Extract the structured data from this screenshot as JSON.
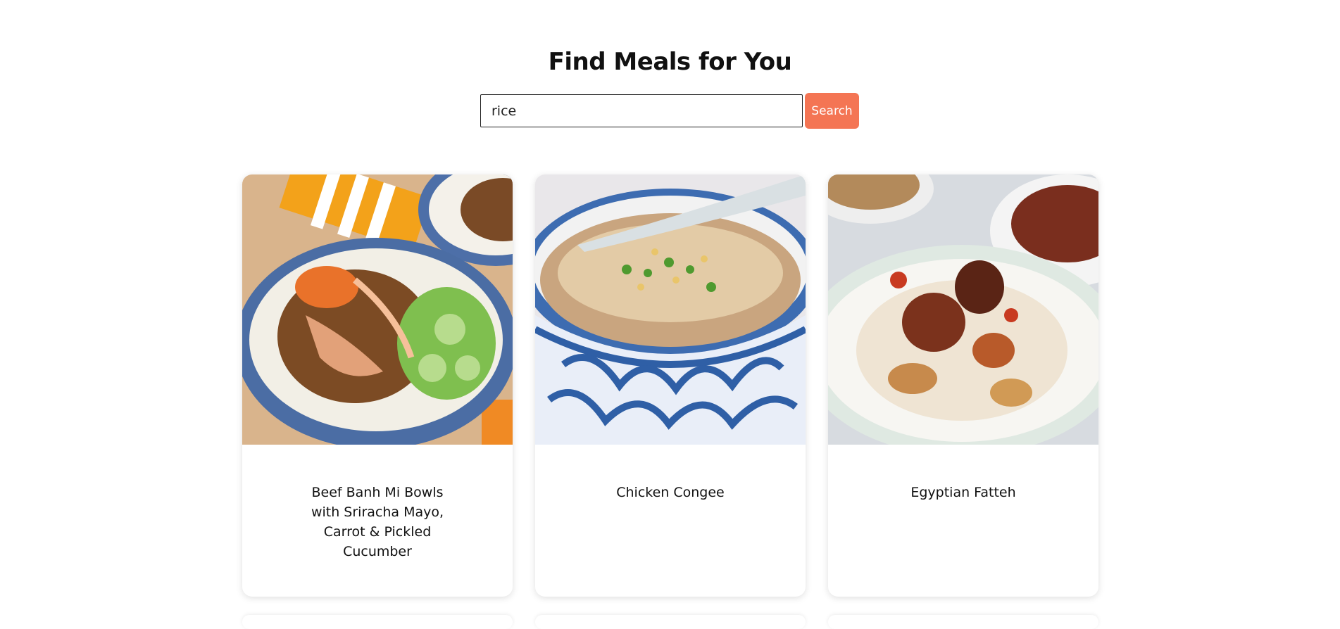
{
  "header": {
    "title": "Find Meals for You"
  },
  "search": {
    "value": "rice",
    "button_label": "Search"
  },
  "meals": [
    {
      "name": "Beef Banh Mi Bowls with Sriracha Mayo, Carrot & Pickled Cucumber",
      "image": "beef-banh-mi-bowl-photo"
    },
    {
      "name": "Chicken Congee",
      "image": "chicken-congee-photo"
    },
    {
      "name": "Egyptian Fatteh",
      "image": "egyptian-fatteh-photo"
    }
  ]
}
